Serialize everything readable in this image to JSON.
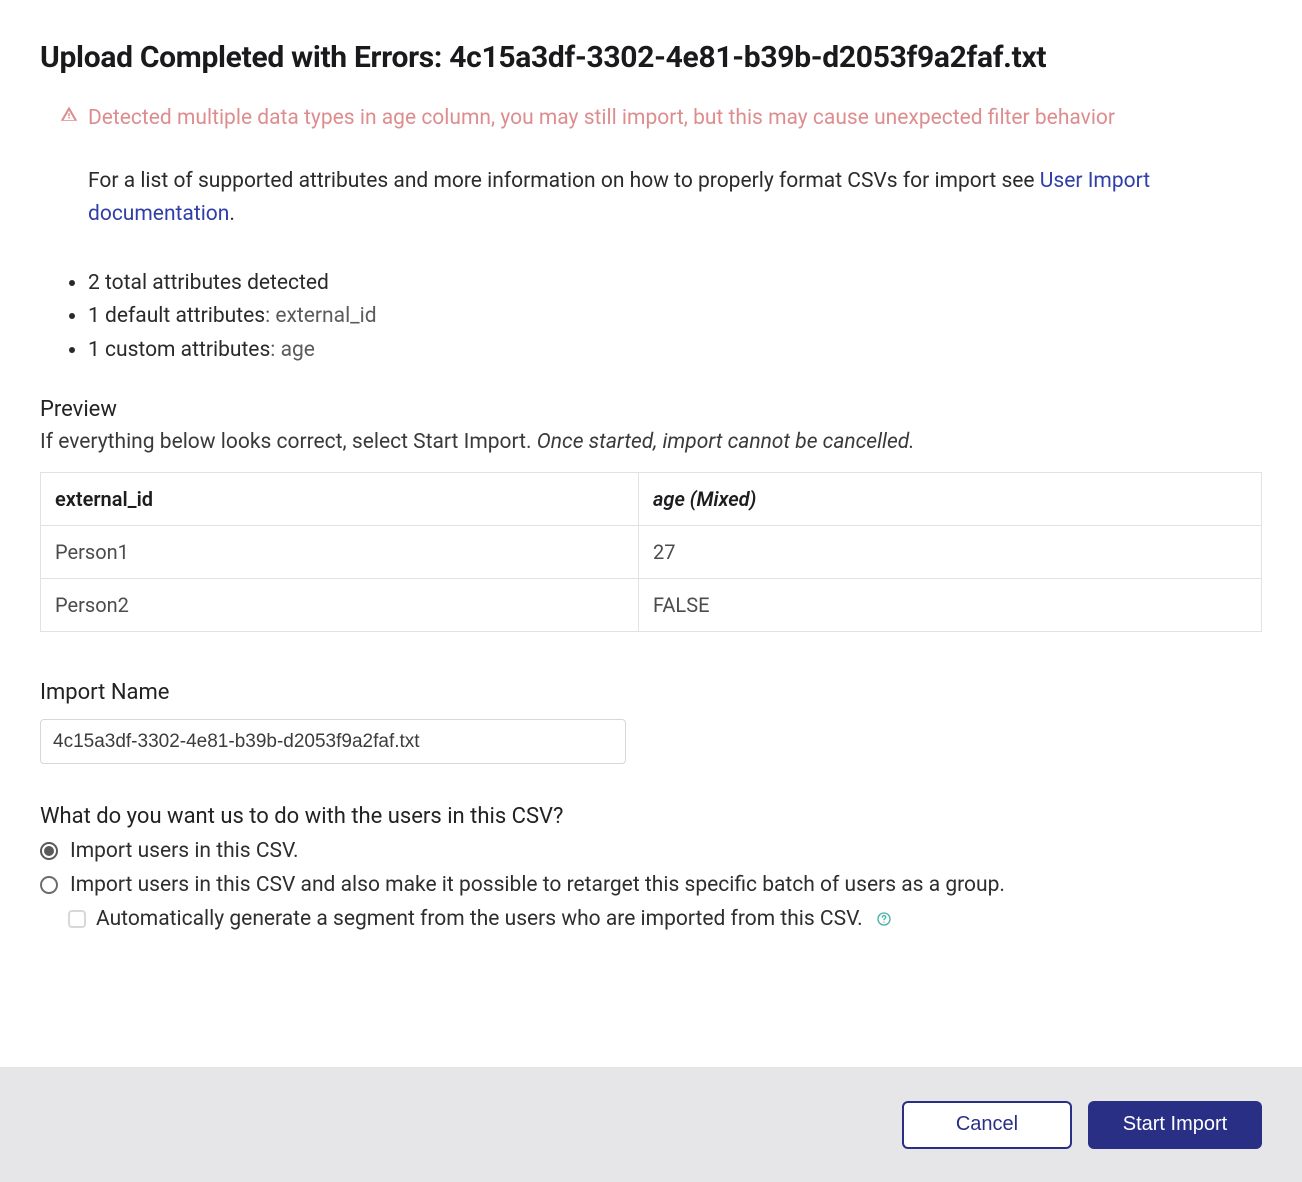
{
  "page_title": "Upload Completed with Errors: 4c15a3df-3302-4e81-b39b-d2053f9a2faf.txt",
  "warning": {
    "text": "Detected multiple data types in age column, you may still import, but this may cause unexpected filter behavior"
  },
  "info": {
    "prefix": "For a list of supported attributes and more information on how to properly format CSVs for import see ",
    "link_text": "User Import documentation",
    "suffix": "."
  },
  "attributes": {
    "total": "2 total attributes detected",
    "default_label": "1 default attributes",
    "default_value": ": external_id",
    "custom_label": "1 custom attributes",
    "custom_value": ": age"
  },
  "preview": {
    "heading": "Preview",
    "subtext_plain": "If everything below looks correct, select Start Import. ",
    "subtext_italic": "Once started, import cannot be cancelled.",
    "columns": [
      "external_id",
      "age (Mixed)"
    ],
    "rows": [
      {
        "external_id": "Person1",
        "age": "27"
      },
      {
        "external_id": "Person2",
        "age": "FALSE"
      }
    ]
  },
  "import_name": {
    "label": "Import Name",
    "value": "4c15a3df-3302-4e81-b39b-d2053f9a2faf.txt"
  },
  "question": {
    "heading": "What do you want us to do with the users in this CSV?",
    "option1": "Import users in this CSV.",
    "option2": "Import users in this CSV and also make it possible to retarget this specific batch of users as a group.",
    "checkbox": "Automatically generate a segment from the users who are imported from this CSV."
  },
  "footer": {
    "cancel": "Cancel",
    "start": "Start Import"
  }
}
